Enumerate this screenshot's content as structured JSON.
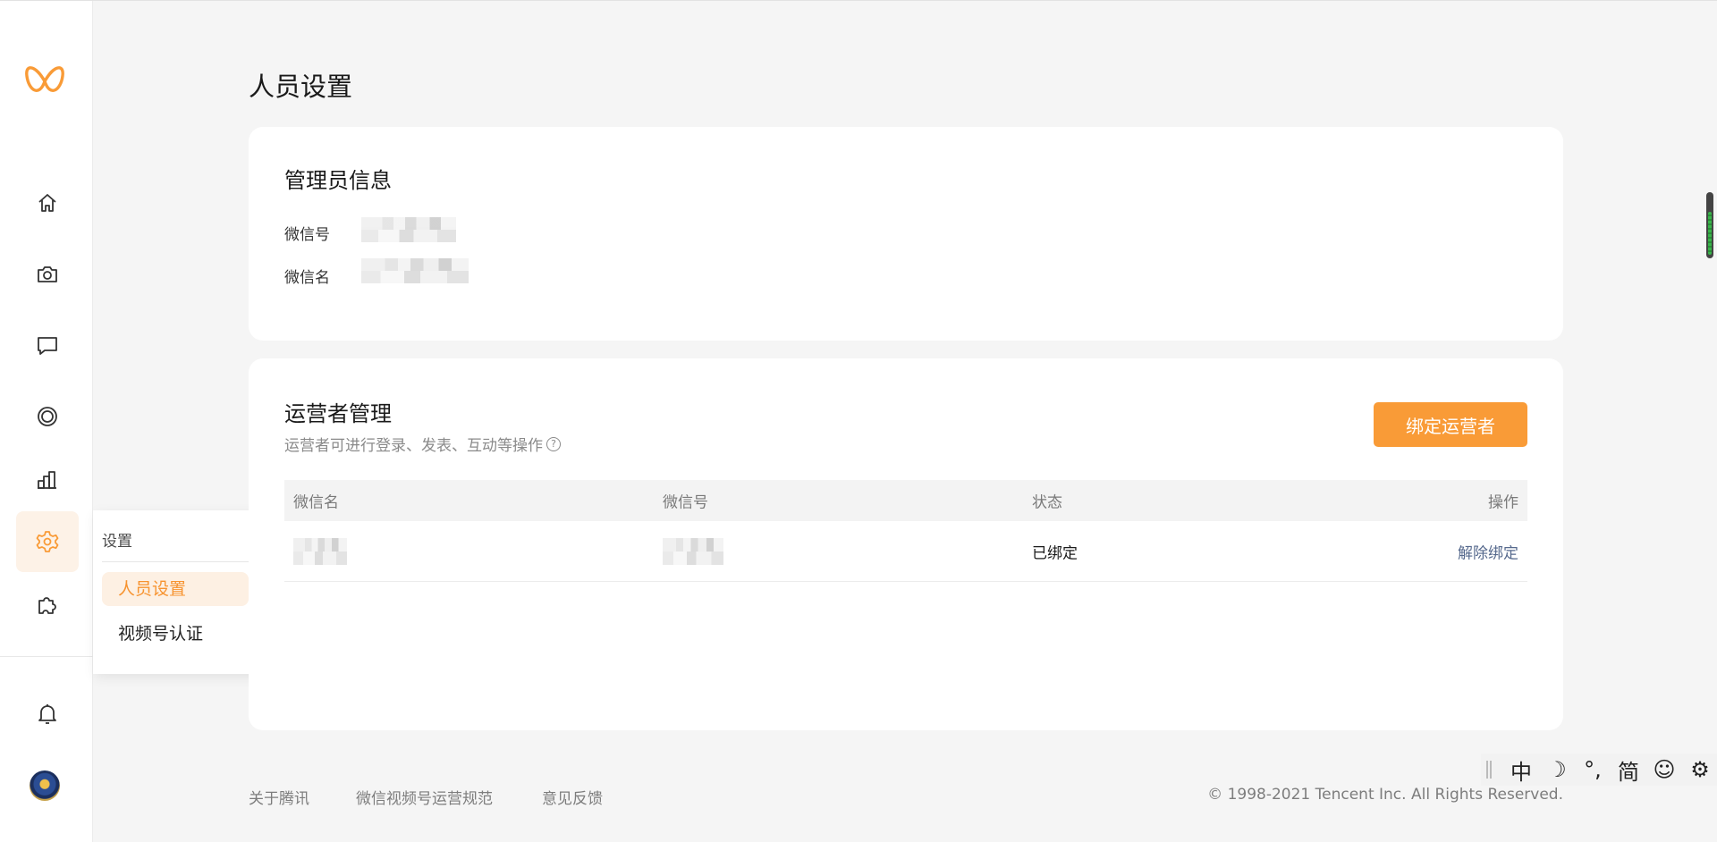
{
  "colors": {
    "accent": "#f99b37",
    "accent_soft": "#fdf0e3",
    "link": "#56698d",
    "background": "#f5f5f5"
  },
  "rail": {
    "logo_icon": "butterfly-logo",
    "items": [
      {
        "icon": "home-icon"
      },
      {
        "icon": "camera-icon"
      },
      {
        "icon": "comment-icon"
      },
      {
        "icon": "target-icon"
      },
      {
        "icon": "bar-chart-icon"
      },
      {
        "icon": "gear-icon",
        "active": true
      },
      {
        "icon": "puzzle-icon"
      }
    ],
    "bottom": [
      {
        "icon": "bell-icon"
      },
      {
        "icon": "avatar"
      }
    ]
  },
  "popup": {
    "title": "设置",
    "items": [
      {
        "label": "人员设置",
        "active": true
      },
      {
        "label": "视频号认证",
        "active": false
      }
    ]
  },
  "page": {
    "title": "人员设置"
  },
  "admin": {
    "heading": "管理员信息",
    "wechat_id_label": "微信号",
    "wechat_name_label": "微信名"
  },
  "operators": {
    "heading": "运营者管理",
    "subtitle": "运营者可进行登录、发表、互动等操作",
    "bind_button": "绑定运营者",
    "columns": [
      "微信名",
      "微信号",
      "状态",
      "操作"
    ],
    "rows": [
      {
        "status": "已绑定",
        "action": "解除绑定"
      }
    ]
  },
  "footer": {
    "links": [
      "关于腾讯",
      "微信视频号运营规范",
      "意见反馈"
    ],
    "copyright": "© 1998-2021 Tencent Inc. All Rights Reserved."
  },
  "ime": {
    "items": [
      "中",
      "☽",
      "°,",
      "简",
      "☺",
      "⚙"
    ]
  }
}
